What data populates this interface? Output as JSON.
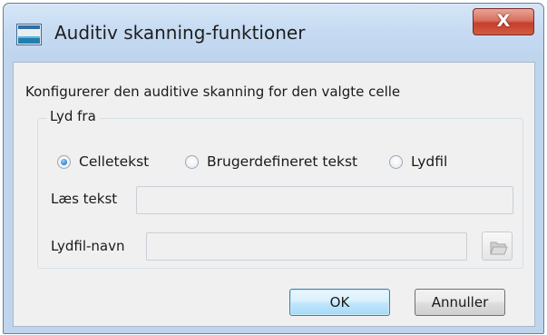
{
  "window": {
    "title": "Auditiv skanning-funktioner",
    "close_label": "X"
  },
  "description": "Konfigurerer den auditive skanning for den valgte celle",
  "sound_group": {
    "legend": "Lyd fra",
    "options": [
      {
        "label": "Celletekst",
        "selected": true
      },
      {
        "label": "Brugerdefineret tekst",
        "selected": false
      },
      {
        "label": "Lydfil",
        "selected": false
      }
    ]
  },
  "read_text": {
    "label": "Læs tekst",
    "value": ""
  },
  "sound_file": {
    "label": "Lydfil-navn",
    "value": ""
  },
  "buttons": {
    "ok": "OK",
    "cancel": "Annuller"
  },
  "colors": {
    "title_gradient": "#c6dbf2",
    "close_red": "#c6402d",
    "ok_blue": "#3c7fb1",
    "radio_selected": "#2a7fcf"
  },
  "icons": {
    "app": "window-app-icon",
    "browse": "folder-open-icon"
  }
}
